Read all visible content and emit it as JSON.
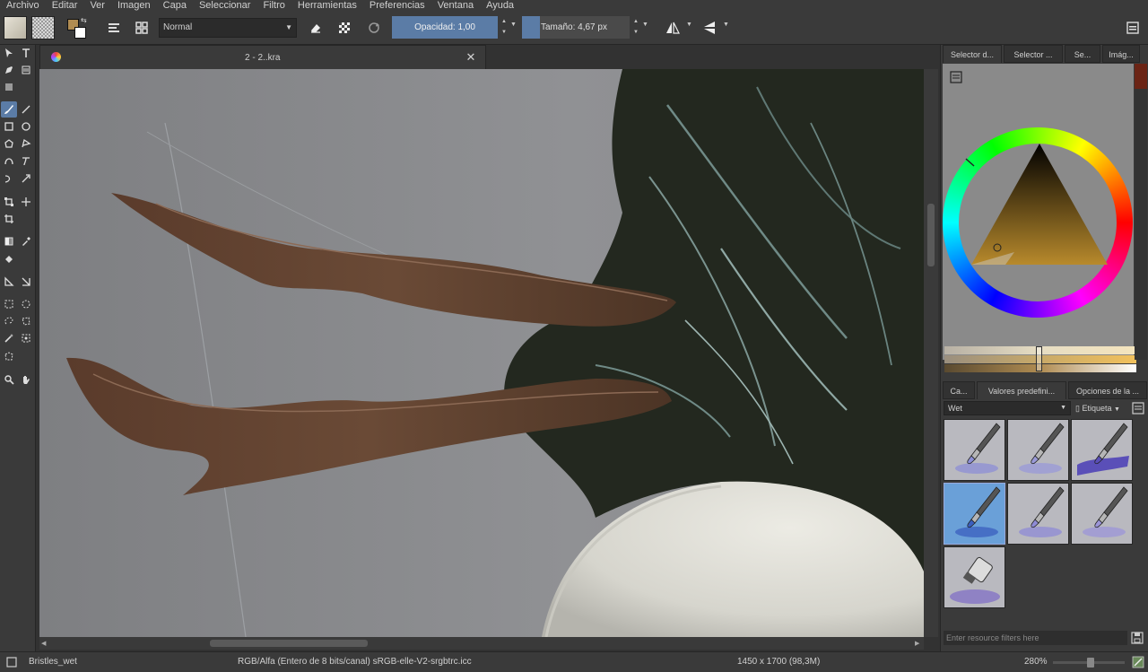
{
  "menu": [
    "Archivo",
    "Editar",
    "Ver",
    "Imagen",
    "Capa",
    "Seleccionar",
    "Filtro",
    "Herramientas",
    "Preferencias",
    "Ventana",
    "Ayuda"
  ],
  "toolbar": {
    "blend_mode": "Normal",
    "opacity_label": "Opacidad:",
    "opacity_value": "1,00",
    "size_label": "Tamaño:",
    "size_value": "4,67 px"
  },
  "document": {
    "tab_title": "2 - 2..kra"
  },
  "docker": {
    "top_tabs": [
      "Selector d...",
      "Selector ...",
      "Se...",
      "Imág..."
    ],
    "preset_tabs": [
      "Ca...",
      "Valores predefini...",
      "Opciones de la ..."
    ],
    "preset_filter": "Wet",
    "tag_label": "Etiqueta",
    "resource_filter_placeholder": "Enter resource filters here",
    "presets": [
      {
        "id": "wet-1",
        "stroke_color": "#8d8fd6"
      },
      {
        "id": "wet-2",
        "stroke_color": "#9a9ad8"
      },
      {
        "id": "wet-3",
        "stroke_color": "#5a4fb8"
      },
      {
        "id": "wet-4",
        "stroke_color": "#3b5fbf"
      },
      {
        "id": "wet-5",
        "stroke_color": "#8f8bd6"
      },
      {
        "id": "wet-6",
        "stroke_color": "#9c95d8"
      },
      {
        "id": "wet-7",
        "stroke_color": "#7e6bc6"
      }
    ]
  },
  "status": {
    "brush_preset": "Bristles_wet",
    "color_space": "RGB/Alfa (Entero de 8 bits/canal)  sRGB-elle-V2-srgbtrc.icc",
    "image_size": "1450 x 1700 (98,3M)",
    "zoom": "280%"
  },
  "colors": {
    "accent": "#5b7ca6",
    "panel": "#3a3a3a",
    "canvas_bg": "#8a8b8d",
    "hair_dark": "#23281f",
    "hair_brown": "#5c3f2d",
    "foreground": "#b08c52",
    "background": "#ffffff"
  }
}
